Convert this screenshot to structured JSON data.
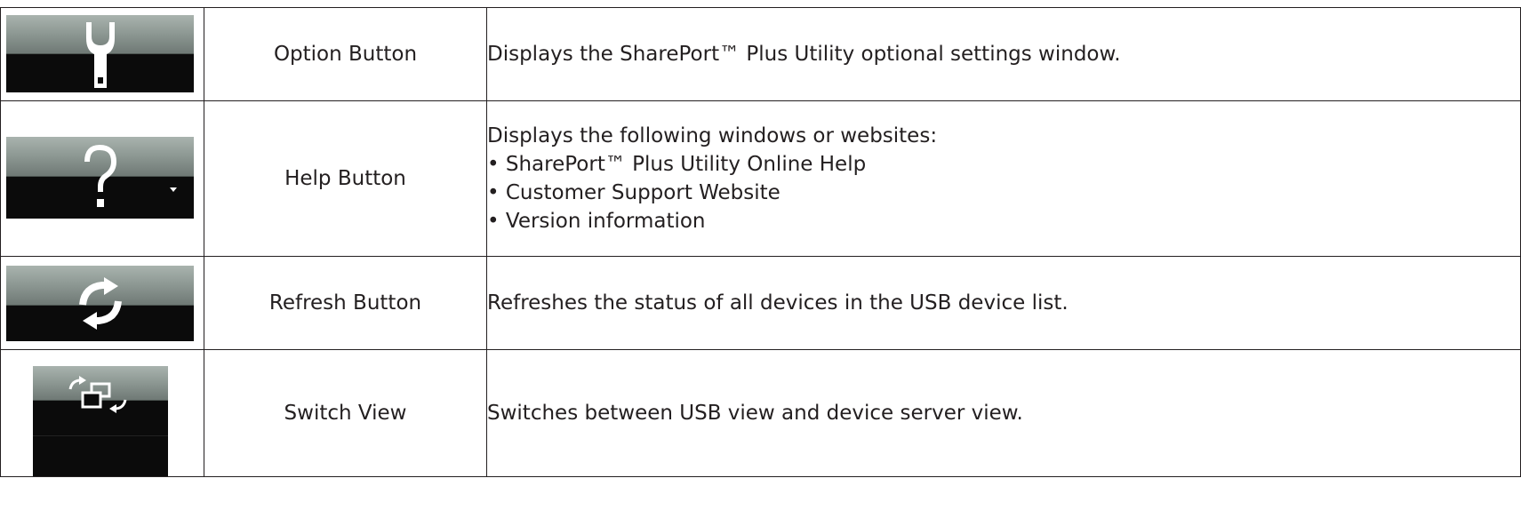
{
  "rows": [
    {
      "name": "Option Button",
      "icon": "wrench-icon",
      "description": [
        "Displays the SharePort™ Plus Utility optional settings window."
      ]
    },
    {
      "name": "Help Button",
      "icon": "question-mark-icon",
      "description": [
        "Displays the following windows or websites:",
        "• SharePort™ Plus Utility Online Help",
        "• Customer Support Website",
        "• Version information"
      ]
    },
    {
      "name": "Refresh Button",
      "icon": "refresh-icon",
      "description": [
        "Refreshes the status of all devices in the USB device list."
      ]
    },
    {
      "name": "Switch View",
      "icon": "switch-view-icon",
      "description": [
        "Switches between USB view and device server view."
      ]
    }
  ],
  "colors": {
    "border": "#231f20",
    "button_dark": "#0b0b0b",
    "button_gradient_top": "#a9b3ae",
    "button_gradient_bottom": "#6f7975",
    "glyph": "#ffffff"
  }
}
